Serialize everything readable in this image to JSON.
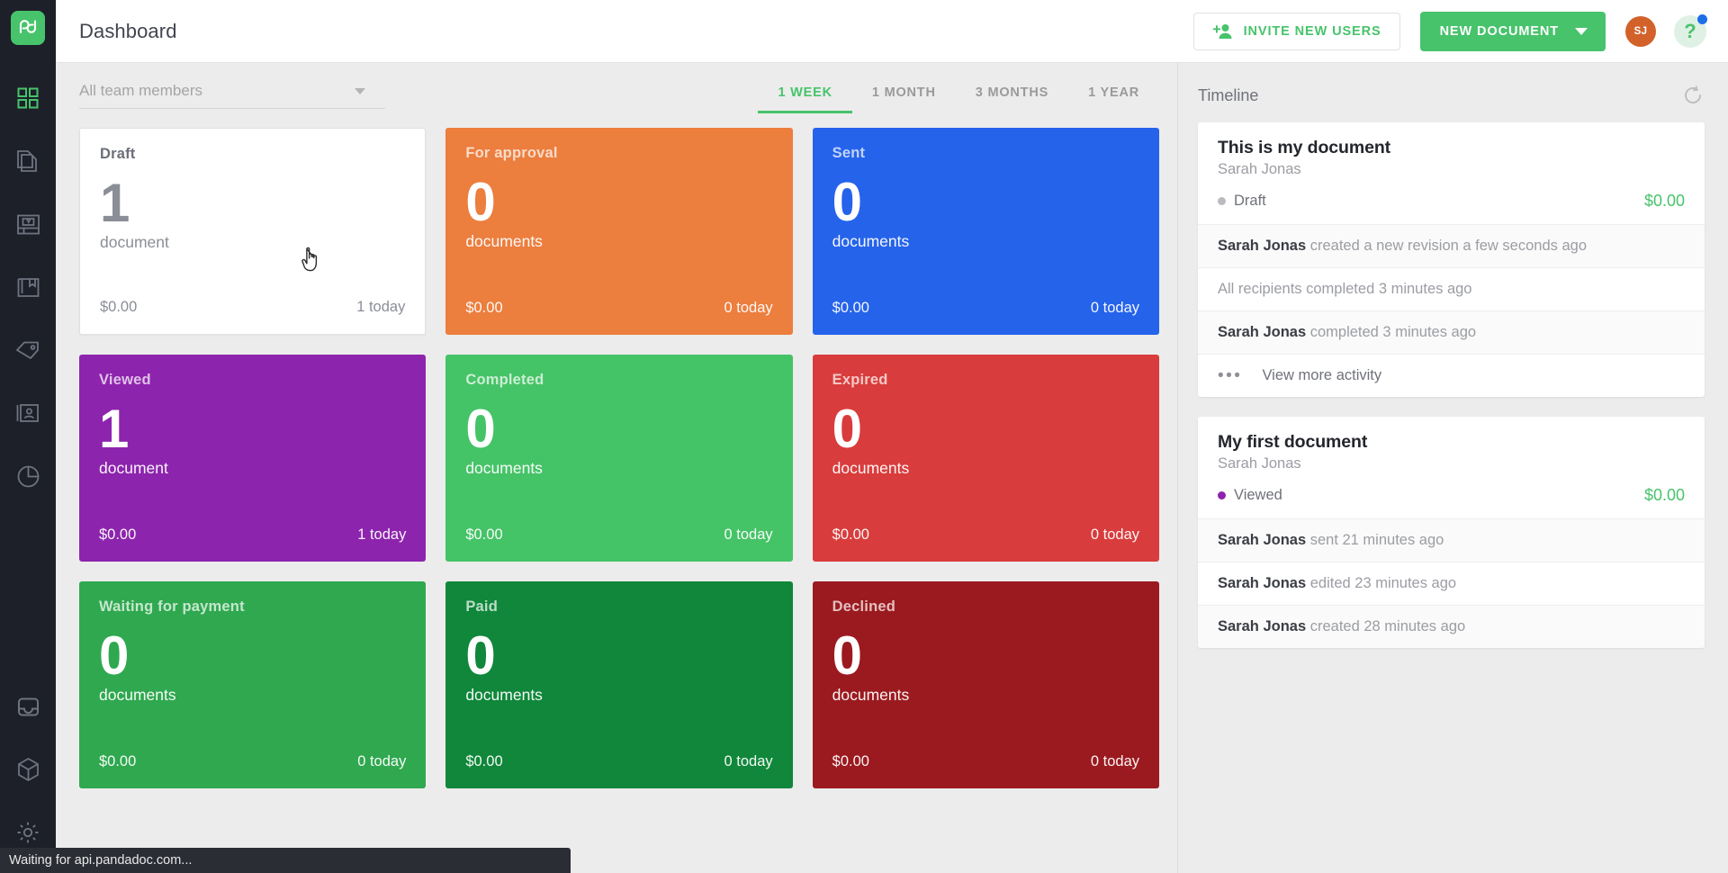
{
  "app": {
    "logo_text": "pd",
    "accent_green": "#47c36b"
  },
  "sidebar": {
    "items": [
      {
        "name": "dashboard",
        "icon": "grid-icon",
        "active": true
      },
      {
        "name": "documents",
        "icon": "documents-icon",
        "active": false
      },
      {
        "name": "templates",
        "icon": "template-icon",
        "active": false
      },
      {
        "name": "content-library",
        "icon": "book-icon",
        "active": false
      },
      {
        "name": "catalog",
        "icon": "tag-icon",
        "active": false
      },
      {
        "name": "contacts",
        "icon": "contact-card-icon",
        "active": false
      },
      {
        "name": "reports",
        "icon": "pie-chart-icon",
        "active": false
      }
    ],
    "bottom_items": [
      {
        "name": "inbox",
        "icon": "inbox-icon"
      },
      {
        "name": "integrations",
        "icon": "cube-icon"
      },
      {
        "name": "settings",
        "icon": "gear-icon"
      }
    ]
  },
  "topbar": {
    "title": "Dashboard",
    "invite_label": "INVITE NEW USERS",
    "new_document_label": "NEW DOCUMENT",
    "avatar_initials": "SJ",
    "help_glyph": "?"
  },
  "filters": {
    "team_placeholder": "All team members",
    "ranges": [
      {
        "label": "1 WEEK",
        "active": true
      },
      {
        "label": "1 MONTH",
        "active": false
      },
      {
        "label": "3 MONTHS",
        "active": false
      },
      {
        "label": "1 YEAR",
        "active": false
      }
    ]
  },
  "cards": [
    {
      "title": "Draft",
      "count": "1",
      "unit": "document",
      "amount": "$0.00",
      "today": "1 today",
      "color": "#ffffff",
      "variant": "light"
    },
    {
      "title": "For approval",
      "count": "0",
      "unit": "documents",
      "amount": "$0.00",
      "today": "0 today",
      "color": "#ec7e3e",
      "variant": "solid"
    },
    {
      "title": "Sent",
      "count": "0",
      "unit": "documents",
      "amount": "$0.00",
      "today": "0 today",
      "color": "#2563eb",
      "variant": "solid"
    },
    {
      "title": "Viewed",
      "count": "1",
      "unit": "document",
      "amount": "$0.00",
      "today": "1 today",
      "color": "#8d24ad",
      "variant": "solid"
    },
    {
      "title": "Completed",
      "count": "0",
      "unit": "documents",
      "amount": "$0.00",
      "today": "0 today",
      "color": "#45c367",
      "variant": "solid"
    },
    {
      "title": "Expired",
      "count": "0",
      "unit": "documents",
      "amount": "$0.00",
      "today": "0 today",
      "color": "#d93c3c",
      "variant": "solid"
    },
    {
      "title": "Waiting for payment",
      "count": "0",
      "unit": "documents",
      "amount": "$0.00",
      "today": "0 today",
      "color": "#2fa84f",
      "variant": "solid"
    },
    {
      "title": "Paid",
      "count": "0",
      "unit": "documents",
      "amount": "$0.00",
      "today": "0 today",
      "color": "#10873a",
      "variant": "solid"
    },
    {
      "title": "Declined",
      "count": "0",
      "unit": "documents",
      "amount": "$0.00",
      "today": "0 today",
      "color": "#9b1a1f",
      "variant": "solid"
    }
  ],
  "timeline": {
    "title": "Timeline",
    "refresh_icon": "refresh-icon",
    "documents": [
      {
        "name": "This is my document",
        "owner": "Sarah Jonas",
        "status": "Draft",
        "status_color": "#b9bbc0",
        "amount": "$0.00",
        "activity": [
          {
            "actor": "Sarah Jonas",
            "text": "created a new revision a few seconds ago"
          },
          {
            "actor": "",
            "text": "All recipients completed 3 minutes ago"
          },
          {
            "actor": "Sarah Jonas",
            "text": "completed 3 minutes ago"
          }
        ],
        "more_label": "View more activity",
        "has_more": true
      },
      {
        "name": "My first document",
        "owner": "Sarah Jonas",
        "status": "Viewed",
        "status_color": "#8d24ad",
        "amount": "$0.00",
        "activity": [
          {
            "actor": "Sarah Jonas",
            "text": "sent 21 minutes ago"
          },
          {
            "actor": "Sarah Jonas",
            "text": "edited 23 minutes ago"
          },
          {
            "actor": "Sarah Jonas",
            "text": "created 28 minutes ago"
          }
        ],
        "more_label": "",
        "has_more": false
      }
    ]
  },
  "statusbar": {
    "text": "Waiting for api.pandadoc.com..."
  }
}
